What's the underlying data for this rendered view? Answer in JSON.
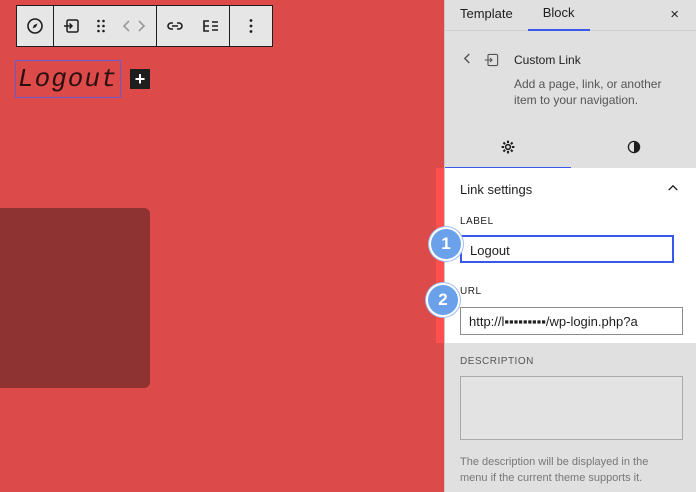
{
  "toolbar": {
    "buttons": [
      "compass-icon",
      "custom-link-icon",
      "drag-handle-icon",
      "move-arrows-icon",
      "link-icon",
      "submenu-icon",
      "more-options-icon"
    ]
  },
  "canvas": {
    "block_text": "Logout",
    "add_button": "+"
  },
  "sidebar": {
    "tabs": [
      "Template",
      "Block"
    ],
    "active_tab": "Block",
    "close_label": "×",
    "block_card": {
      "title": "Custom Link",
      "description": "Add a page, link, or another item to your navigation."
    },
    "link_settings": {
      "title": "Link settings",
      "label_field": {
        "label": "LABEL",
        "value": "Logout"
      },
      "url_field": {
        "label": "URL",
        "value": "http://l▪▪▪▪▪▪▪▪▪/wp-login.php?a"
      }
    },
    "description_field": {
      "label": "DESCRIPTION",
      "value": "",
      "help": "The description will be displayed in the menu if the current theme supports it."
    }
  },
  "annotations": {
    "badge_1": "1",
    "badge_2": "2"
  },
  "colors": {
    "canvas_bg": "#dc4a4a",
    "accent": "#3858e9",
    "badge": "#6aa1ea"
  }
}
